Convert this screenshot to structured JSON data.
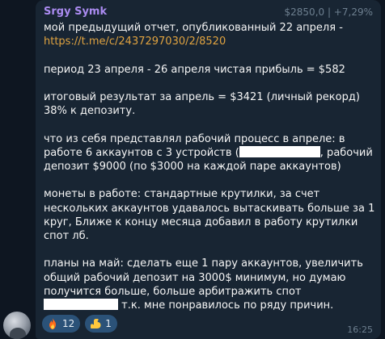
{
  "message": {
    "sender": "Srgy Symk",
    "price_badge": "$2850,0 | +7,29%",
    "line1_prefix": "мой предыдущий отчет, опубликованный 22 апреля -",
    "link": "https://t.me/c/2437297030/2/8520",
    "paragraph_period": "период 23 апреля - 26 апреля чистая прибыль = $582",
    "paragraph_result": "итоговый результат за апрель = $3421 (личный рекорд)  38% к депозиту.",
    "paragraph_process_a": "что из себя представлял рабочий процесс в апреле: в работе 6 аккаунтов с 3 устройств (",
    "paragraph_process_b": ", рабочий депозит $9000 (по $3000 на каждой паре аккаунтов)",
    "paragraph_coins": "монеты в работе: стандартные крутилки, за счет нескольких аккаунтов удавалось вытаскивать больше за 1 круг, Ближе к концу месяца добавил в работу крутилки спот лб.",
    "paragraph_plans_a": "планы на май: сделать еще 1 пару аккаунтов, увеличить общий рабочий депозит на 3000$ минимум, но думаю получится больше, больше арбитражить спот",
    "paragraph_plans_b": " т.к. мне понравилось по ряду причин.",
    "time": "16:25"
  },
  "reactions": [
    {
      "emoji": "fire-icon",
      "count": "12"
    },
    {
      "emoji": "flexed-biceps-icon",
      "count": "1"
    }
  ],
  "colors": {
    "background": "#0e1621",
    "bubble": "#182533",
    "sender": "#aa8bf0",
    "link": "#e0a340",
    "reaction_bg": "#2b5278"
  }
}
